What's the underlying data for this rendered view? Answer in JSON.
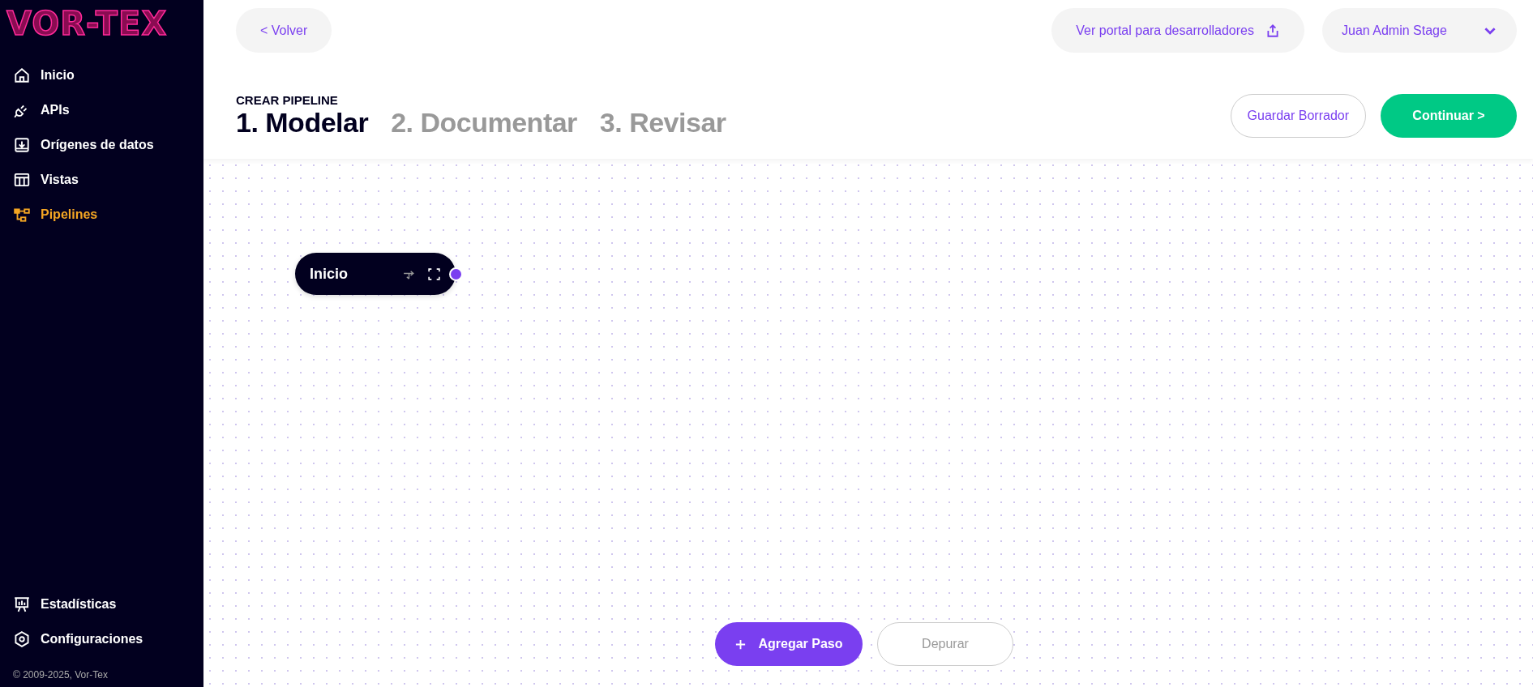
{
  "sidebar": {
    "logo": "VOR-TEX",
    "items": [
      {
        "label": "Inicio",
        "selected": false
      },
      {
        "label": "APIs",
        "selected": false
      },
      {
        "label": "Orígenes de datos",
        "selected": false
      },
      {
        "label": "Vistas",
        "selected": false
      },
      {
        "label": "Pipelines",
        "selected": true
      }
    ],
    "bottom_items": [
      {
        "label": "Estadísticas",
        "selected": false
      },
      {
        "label": "Configuraciones",
        "selected": false
      }
    ],
    "copyright": "© 2009-2025, Vor-Tex"
  },
  "topbar": {
    "back": "< Volver",
    "portal": "Ver portal para desarrolladores",
    "user": "Juan Admin Stage"
  },
  "header": {
    "eyebrow": "CREAR PIPELINE",
    "steps": [
      {
        "label": "1. Modelar",
        "selected": true
      },
      {
        "label": "2. Documentar",
        "selected": false
      },
      {
        "label": "3. Revisar",
        "selected": false
      }
    ],
    "buttons": {
      "draft": "Guardar Borrador",
      "continue": "Continuar >"
    }
  },
  "canvas": {
    "nodes": [
      {
        "title": "Inicio"
      }
    ]
  },
  "actions": {
    "add": "Agregar Paso",
    "debug": "Depurar"
  }
}
